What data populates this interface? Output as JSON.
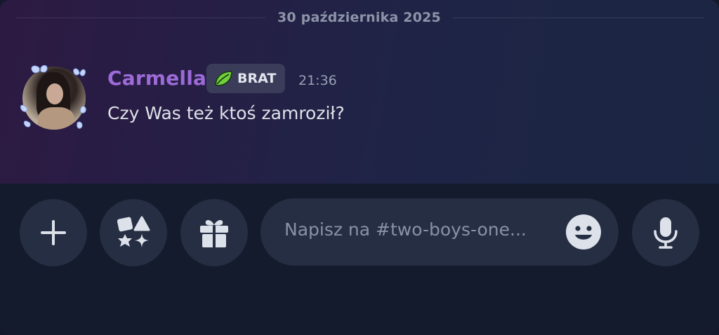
{
  "chat": {
    "date_separator": "30 października 2025",
    "message": {
      "username": "Carmella",
      "tag_label": "BRAT",
      "tag_icon": "leaf-icon",
      "time": "21:36",
      "text": "Czy Was też ktoś zamroził?"
    }
  },
  "composer": {
    "buttons": [
      {
        "name": "add-button",
        "icon": "plus-icon"
      },
      {
        "name": "apps-button",
        "icon": "apps-icon"
      },
      {
        "name": "gift-button",
        "icon": "gift-icon"
      },
      {
        "name": "voice-button",
        "icon": "microphone-icon"
      }
    ],
    "input_placeholder": "Napisz na #two-boys-one...",
    "emoji_icon": "emoji-icon"
  },
  "colors": {
    "username": "#9d6bd8",
    "tag_icon_green": "#6fcf3c",
    "background_top": "#2d1a42",
    "composer_bg": "#131b2d",
    "button_bg": "#252e42"
  }
}
